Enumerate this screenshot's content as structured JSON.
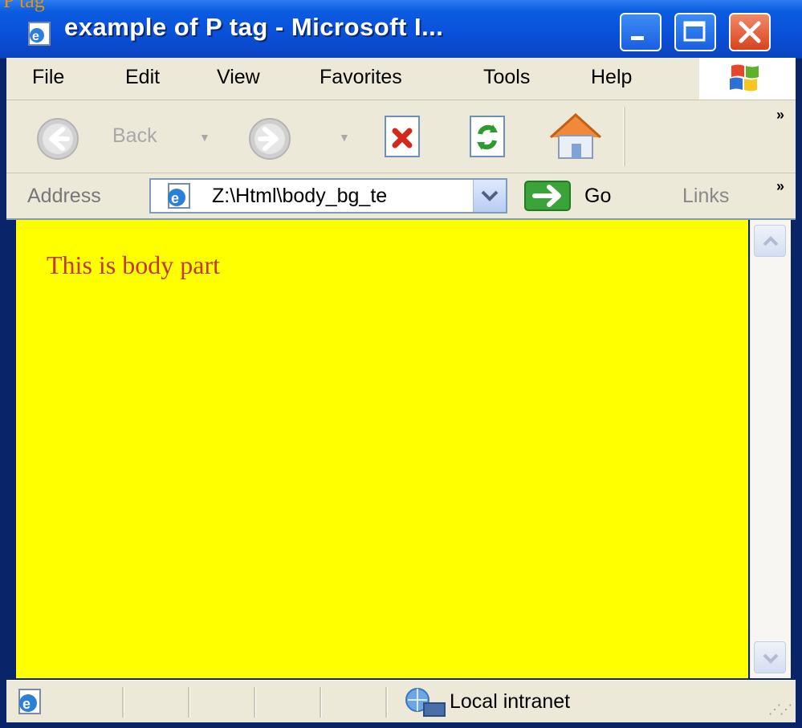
{
  "overlay_text": "P tag",
  "window": {
    "title": "example of P tag - Microsoft I..."
  },
  "menubar": {
    "items": [
      "File",
      "Edit",
      "View",
      "Favorites",
      "Tools",
      "Help"
    ]
  },
  "toolbar": {
    "back_label": "Back",
    "more": "»"
  },
  "addressbar": {
    "label": "Address",
    "url": "Z:\\Html\\body_bg_te",
    "go_label": "Go",
    "links_label": "Links",
    "more": "»"
  },
  "content": {
    "text": "This is body part",
    "background": "#ffff00",
    "text_color": "#c0392b"
  },
  "statusbar": {
    "zone": "Local intranet"
  },
  "colors": {
    "titlebar": "#0a50d8",
    "chrome": "#ece9d8"
  }
}
